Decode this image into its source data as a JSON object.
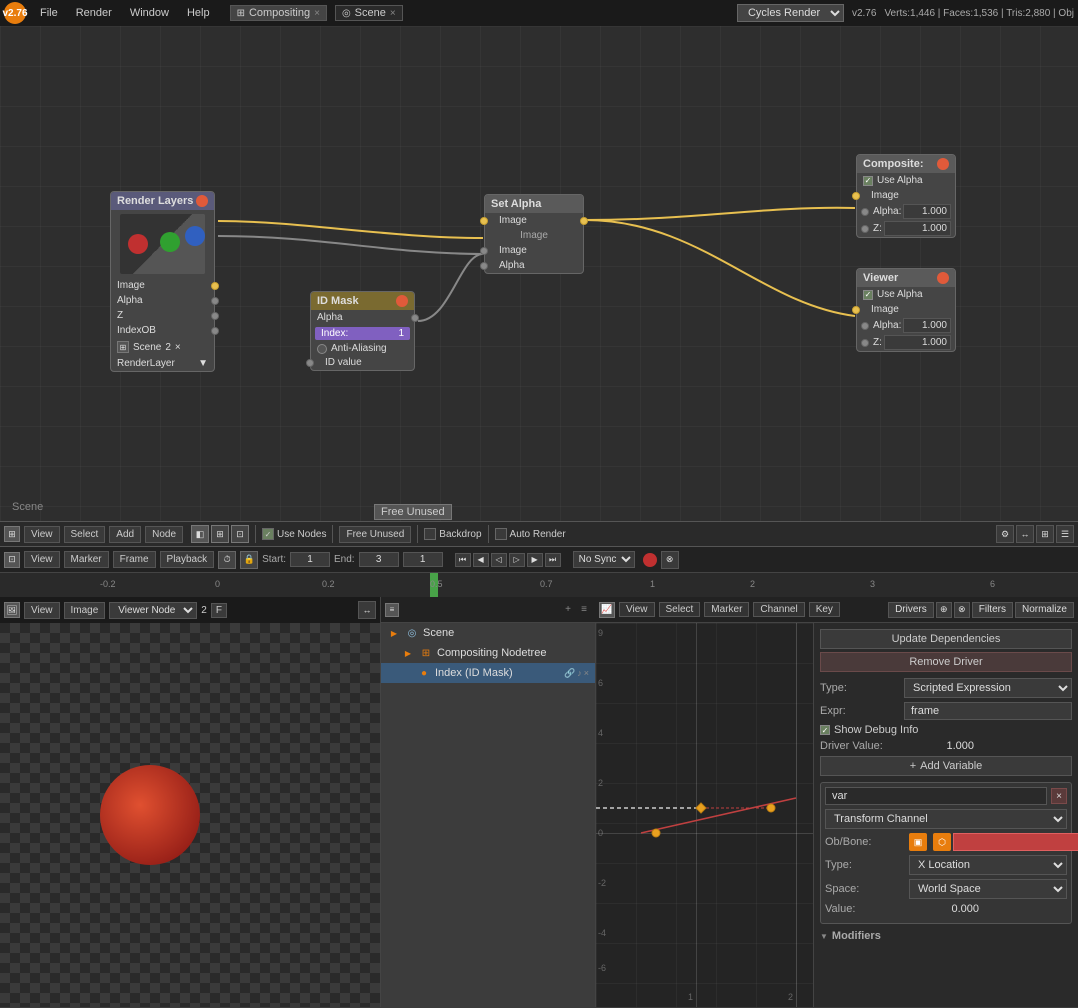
{
  "app": {
    "version": "v2.76",
    "stats": "Verts:1,446 | Faces:1,536 | Tris:2,880 | Obj",
    "engine": "Cycles Render"
  },
  "topbar": {
    "logo": "B",
    "menus": [
      "File",
      "Render",
      "Window",
      "Help"
    ],
    "workspace_tabs": [
      {
        "label": "Compositing",
        "active": true
      },
      {
        "label": "Scene",
        "active": false
      }
    ]
  },
  "node_editor": {
    "scene_label": "Scene",
    "nodes": {
      "render_layers": {
        "title": "Render Layers",
        "sockets_out": [
          "Image",
          "Alpha",
          "Z",
          "IndexOB"
        ],
        "scene": "Scene",
        "layer": "RenderLayer"
      },
      "id_mask": {
        "title": "ID Mask",
        "socket_out": "Alpha",
        "index_label": "Index:",
        "index_value": "1",
        "anti_aliasing": "Anti-Aliasing",
        "id_value": "ID value"
      },
      "set_alpha": {
        "title": "Set Alpha",
        "header_socket": "Image",
        "sockets_in": [
          "Image",
          "Alpha"
        ],
        "socket_out": "Image"
      },
      "composite": {
        "title": "Composite:",
        "use_alpha": "Use Alpha",
        "image_label": "Image",
        "alpha_label": "Alpha:",
        "alpha_value": "1.000",
        "z_label": "Z:",
        "z_value": "1.000"
      },
      "viewer": {
        "title": "Viewer",
        "use_alpha": "Use Alpha",
        "image_label": "Image",
        "alpha_label": "Alpha:",
        "alpha_value": "1.000",
        "z_label": "Z:",
        "z_value": "1.000"
      }
    }
  },
  "node_toolbar": {
    "view_label": "View",
    "select_label": "Select",
    "add_label": "Add",
    "node_label": "Node",
    "use_nodes_label": "Use Nodes",
    "free_unused_label": "Free Unused",
    "backdrop_label": "Backdrop",
    "auto_render_label": "Auto Render"
  },
  "timeline": {
    "start": "1",
    "end": "3",
    "current": "1",
    "marker_labels": [
      "-0.2",
      "0",
      "0.2",
      "0.5",
      "0.7",
      "1",
      "2",
      "3",
      "6"
    ]
  },
  "scene_tree": {
    "items": [
      {
        "label": "Scene",
        "level": 0,
        "type": "scene"
      },
      {
        "label": "Compositing Nodetree",
        "level": 1,
        "type": "node"
      },
      {
        "label": "Index (ID Mask)",
        "level": 2,
        "type": "driver",
        "selected": true
      }
    ]
  },
  "driver_panel": {
    "update_btn": "Update Dependencies",
    "remove_btn": "Remove Driver",
    "type_label": "Type:",
    "type_value": "Scripted Expression",
    "expr_label": "Expr:",
    "expr_value": "frame",
    "show_debug_label": "Show Debug Info",
    "driver_value_label": "Driver Value:",
    "driver_value": "1.000",
    "add_variable_btn": "Add Variable",
    "variable_name": "var",
    "transform_channel": "Transform Channel",
    "ob_bone_label": "Ob/Bone:",
    "type2_label": "Type:",
    "type2_value": "X Location",
    "space_label": "Space:",
    "space_value": "World Space",
    "value_label": "Value:",
    "value_value": "0.000",
    "modifiers_label": "Modifiers"
  },
  "viewer_statusbar": {
    "view": "View",
    "image": "Image",
    "viewer_node": "Viewer Node",
    "frame": "2",
    "f_label": "F"
  },
  "driver_statusbar": {
    "view": "View",
    "marker": "Marker",
    "frame": "Frame",
    "playback": "Playback",
    "no_sync": "No Sync",
    "drivers": "Drivers",
    "filters": "Filters",
    "normalize": "Normalize"
  }
}
